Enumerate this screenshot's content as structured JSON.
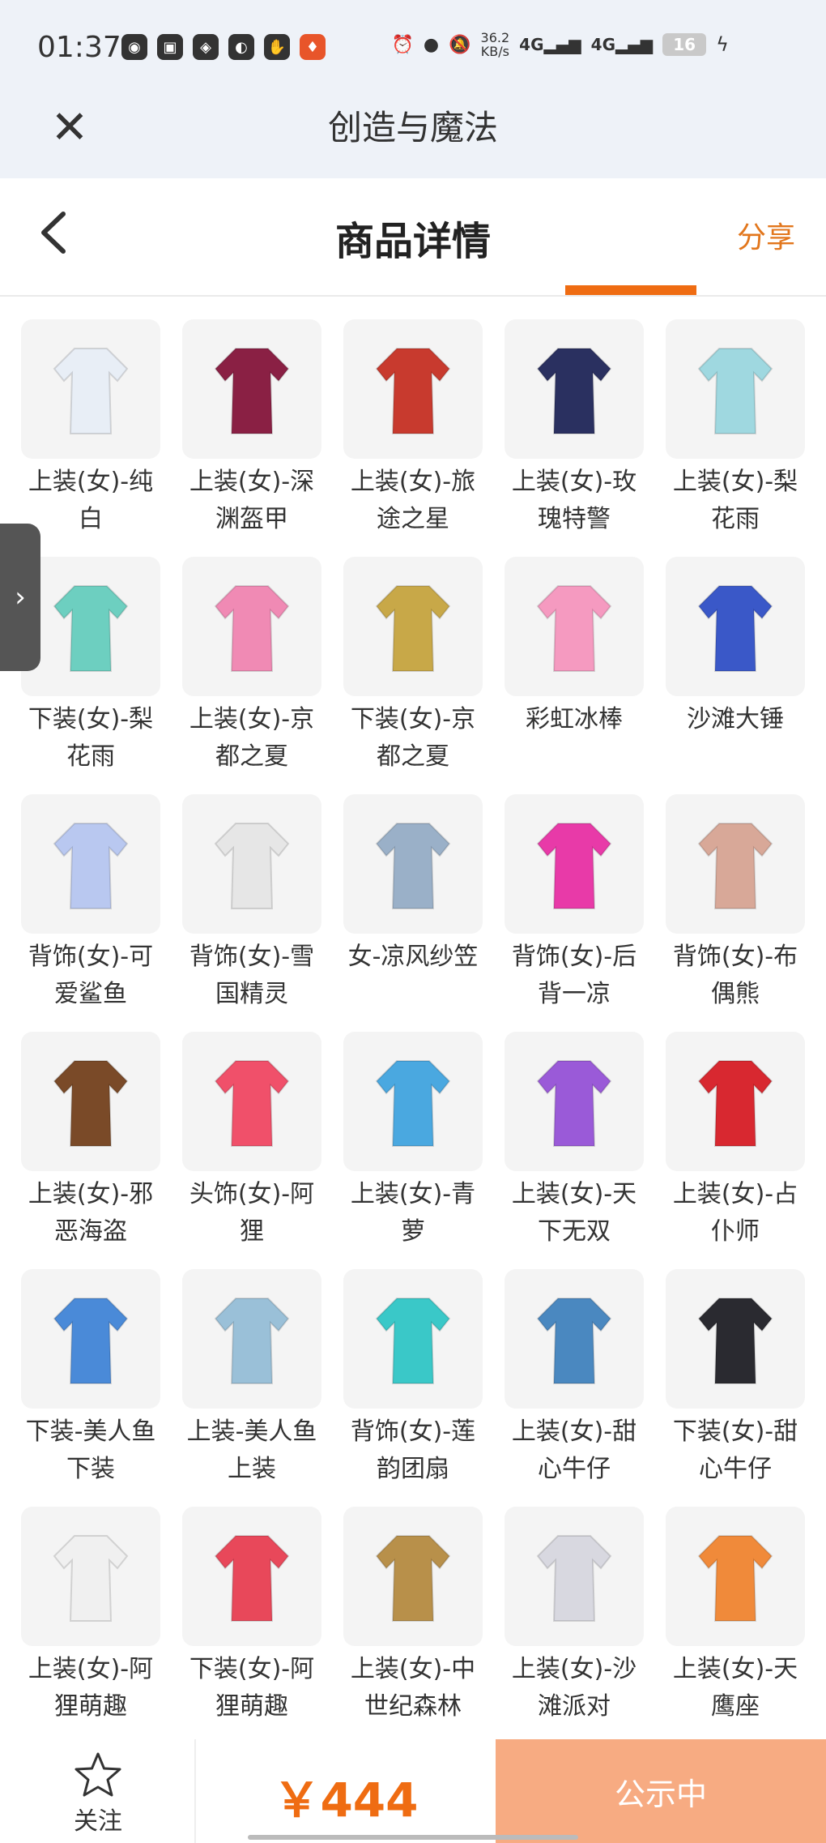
{
  "status_bar": {
    "time": "01:37",
    "speed_top": "36.2",
    "speed_bottom": "KB/s",
    "net1": "4G",
    "net2": "4G",
    "battery": "16"
  },
  "app_bar": {
    "title": "创造与魔法"
  },
  "nav": {
    "title": "商品详情",
    "share_label": "分享"
  },
  "items": [
    {
      "label": "上装(女)-纯白",
      "icon": "white-dress",
      "color": "#e8eef6"
    },
    {
      "label": "上装(女)-深渊盔甲",
      "icon": "abyss-armor",
      "color": "#8a2044"
    },
    {
      "label": "上装(女)-旅途之星",
      "icon": "red-dress",
      "color": "#c83a2e"
    },
    {
      "label": "上装(女)-玫瑰特警",
      "icon": "navy-uniform",
      "color": "#2a3060"
    },
    {
      "label": "上装(女)-梨花雨",
      "icon": "mint-dress",
      "color": "#9fd8e0"
    },
    {
      "label": "下装(女)-梨花雨",
      "icon": "mint-shoes",
      "color": "#6dcfc0"
    },
    {
      "label": "上装(女)-京都之夏",
      "icon": "kimono",
      "color": "#f08ab4"
    },
    {
      "label": "下装(女)-京都之夏",
      "icon": "sandals",
      "color": "#c8a848"
    },
    {
      "label": "彩虹冰棒",
      "icon": "rainbow-popsicle",
      "color": "#f59ac0"
    },
    {
      "label": "沙滩大锤",
      "icon": "beach-hammer",
      "color": "#3a58c8"
    },
    {
      "label": "背饰(女)-可爱鲨鱼",
      "icon": "shark",
      "color": "#b9c8f0"
    },
    {
      "label": "背饰(女)-雪国精灵",
      "icon": "white-wings",
      "color": "#e6e6e6"
    },
    {
      "label": "女-凉风纱笠",
      "icon": "veil-hat",
      "color": "#9ab0c8"
    },
    {
      "label": "背饰(女)-后背一凉",
      "icon": "ice-cream",
      "color": "#e83aa8"
    },
    {
      "label": "背饰(女)-布偶熊",
      "icon": "teddy-bear",
      "color": "#d8a898"
    },
    {
      "label": "上装(女)-邪恶海盗",
      "icon": "pirate-vest",
      "color": "#7a4a28"
    },
    {
      "label": "头饰(女)-阿狸",
      "icon": "fox-head",
      "color": "#f0506a"
    },
    {
      "label": "上装(女)-青萝",
      "icon": "blue-dress",
      "color": "#4aa8e0"
    },
    {
      "label": "上装(女)-天下无双",
      "icon": "purple-dress",
      "color": "#9a5ad8"
    },
    {
      "label": "上装(女)-占仆师",
      "icon": "red-gown",
      "color": "#d82830"
    },
    {
      "label": "下装-美人鱼下装",
      "icon": "mermaid-pants",
      "color": "#4a8ad8"
    },
    {
      "label": "上装-美人鱼上装",
      "icon": "mermaid-top",
      "color": "#9ac0d8"
    },
    {
      "label": "背饰(女)-莲韵团扇",
      "icon": "fan",
      "color": "#3ac8c8"
    },
    {
      "label": "上装(女)-甜心牛仔",
      "icon": "denim-dress",
      "color": "#4a88c0"
    },
    {
      "label": "下装(女)-甜心牛仔",
      "icon": "black-skirt",
      "color": "#2a2a30"
    },
    {
      "label": "上装(女)-阿狸萌趣",
      "icon": "white-hoodie",
      "color": "#f0f0f0"
    },
    {
      "label": "下装(女)-阿狸萌趣",
      "icon": "white-boots",
      "color": "#e8485a"
    },
    {
      "label": "上装(女)-中世纪森林",
      "icon": "medieval-dress",
      "color": "#b8904a"
    },
    {
      "label": "上装(女)-沙滩派对",
      "icon": "beach-top",
      "color": "#d8d8e0"
    },
    {
      "label": "上装(女)-天鹰座",
      "icon": "orange-jacket",
      "color": "#f08a3a"
    }
  ],
  "bottom_bar": {
    "follow_label": "关注",
    "price": "￥444",
    "status_label": "公示中"
  }
}
